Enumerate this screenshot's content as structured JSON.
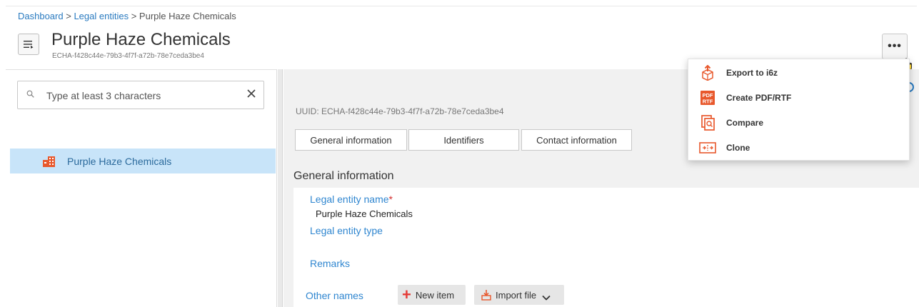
{
  "breadcrumb": {
    "items": [
      "Dashboard",
      "Legal entities",
      "Purple Haze Chemicals"
    ],
    "separator": ">"
  },
  "header": {
    "title": "Purple Haze Chemicals",
    "subtitle": "ECHA-f428c44e-79b3-4f7f-a72b-78e7ceda3be4",
    "more_label": "•••"
  },
  "search": {
    "placeholder": "Type at least 3 characters",
    "value": ""
  },
  "tree": {
    "items": [
      {
        "label": "Purple Haze Chemicals",
        "selected": true
      }
    ]
  },
  "main": {
    "uuid": "UUID: ECHA-f428c44e-79b3-4f7f-a72b-78e7ceda3be4",
    "tabs": [
      {
        "label": "General information"
      },
      {
        "label": "Identifiers"
      },
      {
        "label": "Contact information"
      }
    ],
    "section_title": "General information",
    "fields": {
      "legal_entity_name_label": "Legal entity name",
      "required_marker": "*",
      "legal_entity_name_value": "Purple Haze Chemicals",
      "legal_entity_type_label": "Legal entity type",
      "remarks_label": "Remarks",
      "other_names_label": "Other names"
    },
    "actions": {
      "new_item": "New item",
      "import_file": "Import file"
    }
  },
  "dropdown": {
    "items": [
      {
        "label": "Export to i6z",
        "icon": "export-icon"
      },
      {
        "label": "Create PDF/RTF",
        "icon": "pdf-icon"
      },
      {
        "label": "Compare",
        "icon": "compare-icon"
      },
      {
        "label": "Clone",
        "icon": "clone-icon"
      }
    ]
  },
  "colors": {
    "accent": "#2f86d0",
    "selected_row": "#c8e4f9",
    "icon_orange": "#e8582c",
    "required": "#d32f2f"
  }
}
